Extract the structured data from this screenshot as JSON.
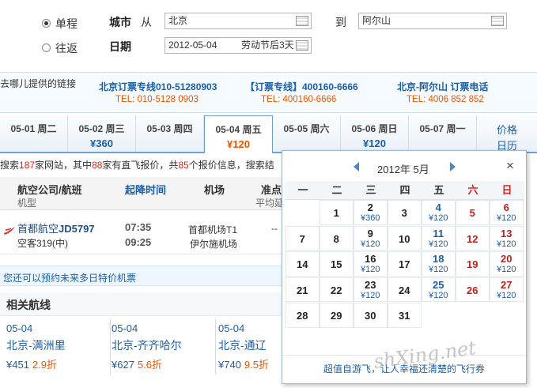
{
  "search": {
    "trip_oneway": "单程",
    "trip_return": "往返",
    "city_label": "城市",
    "from_label": "从",
    "from_value": "北京",
    "to_label": "到",
    "to_value": "阿尔山",
    "date_label": "日期",
    "date_value": "2012-05-04",
    "date_hint": "劳动节后3天"
  },
  "hotlines": {
    "source_link": "去哪儿提供的链接",
    "items": [
      {
        "title": "北京订票专线010-51280903",
        "tel": "TEL: 010-5128 0903"
      },
      {
        "title": "【订票专线】400160-6666",
        "tel": "TEL: 400160-6666"
      },
      {
        "title": "北京-阿尔山 订票电话",
        "tel": "TEL: 4006 852 852"
      }
    ]
  },
  "date_tabs": [
    {
      "date": "05-01 周二",
      "price": ""
    },
    {
      "date": "05-02 周三",
      "price": "¥360"
    },
    {
      "date": "05-03 周四",
      "price": ""
    },
    {
      "date": "05-04 周五",
      "price": "¥120"
    },
    {
      "date": "05-05 周六",
      "price": ""
    },
    {
      "date": "05-06 周日",
      "price": "¥120"
    },
    {
      "date": "05-07 周一",
      "price": ""
    }
  ],
  "price_calendar_link": {
    "line1": "价格",
    "line2": "日历"
  },
  "summary": {
    "p1": "搜索",
    "n1": "187",
    "p2": "家网站，其中",
    "n2": "88",
    "p3": "家有直飞报价，共",
    "n3": "85",
    "p4": "个报价信息，搜索结"
  },
  "columns": {
    "airline": "航空公司/航班",
    "airline_sub": "机型",
    "times": "起降时间",
    "airport": "机场",
    "ontime": "准点",
    "ontime_sub": "平均延"
  },
  "flight": {
    "airline": "首都航空",
    "flight_no": "JD5797",
    "aircraft": "空客319(中)",
    "dep_time": "07:35",
    "arr_time": "09:25",
    "dep_airport": "首都机场T1",
    "arr_airport": "伊尔施机场",
    "ontime": "--"
  },
  "promo_text": "您还可以预约未来多日特价机票",
  "related_title": "相关航线",
  "related_routes": [
    {
      "date": "05-04",
      "route": "北京-满洲里",
      "price": "¥451",
      "discount": "2.9折"
    },
    {
      "date": "05-04",
      "route": "北京-齐齐哈尔",
      "price": "¥627",
      "discount": "5.6折"
    },
    {
      "date": "05-04",
      "route": "北京-通辽",
      "price": "¥740",
      "discount": "9.5折"
    }
  ],
  "calendar": {
    "title": "2012年 5月",
    "close": "×",
    "weekdays": [
      "一",
      "二",
      "三",
      "四",
      "五",
      "六",
      "日"
    ],
    "weekend_color": "#d8251c",
    "days": [
      {
        "d": "1",
        "p": ""
      },
      {
        "d": "2",
        "p": "¥360"
      },
      {
        "d": "3",
        "p": ""
      },
      {
        "d": "4",
        "p": "¥120"
      },
      {
        "d": "5",
        "p": ""
      },
      {
        "d": "6",
        "p": "¥120"
      },
      {
        "d": "7",
        "p": ""
      },
      {
        "d": "8",
        "p": ""
      },
      {
        "d": "9",
        "p": "¥120"
      },
      {
        "d": "10",
        "p": ""
      },
      {
        "d": "11",
        "p": "¥120"
      },
      {
        "d": "12",
        "p": ""
      },
      {
        "d": "13",
        "p": "¥120"
      },
      {
        "d": "14",
        "p": ""
      },
      {
        "d": "15",
        "p": ""
      },
      {
        "d": "16",
        "p": "¥120"
      },
      {
        "d": "17",
        "p": ""
      },
      {
        "d": "18",
        "p": "¥120"
      },
      {
        "d": "19",
        "p": ""
      },
      {
        "d": "20",
        "p": "¥120"
      },
      {
        "d": "21",
        "p": ""
      },
      {
        "d": "22",
        "p": ""
      },
      {
        "d": "23",
        "p": "¥120"
      },
      {
        "d": "24",
        "p": ""
      },
      {
        "d": "25",
        "p": "¥120"
      },
      {
        "d": "26",
        "p": ""
      },
      {
        "d": "27",
        "p": "¥120"
      },
      {
        "d": "28",
        "p": ""
      },
      {
        "d": "29",
        "p": ""
      },
      {
        "d": "30",
        "p": ""
      },
      {
        "d": "31",
        "p": ""
      }
    ],
    "footer": "超值自游飞，让人幸福还清楚的飞行券"
  },
  "watermark": "shXing.net"
}
